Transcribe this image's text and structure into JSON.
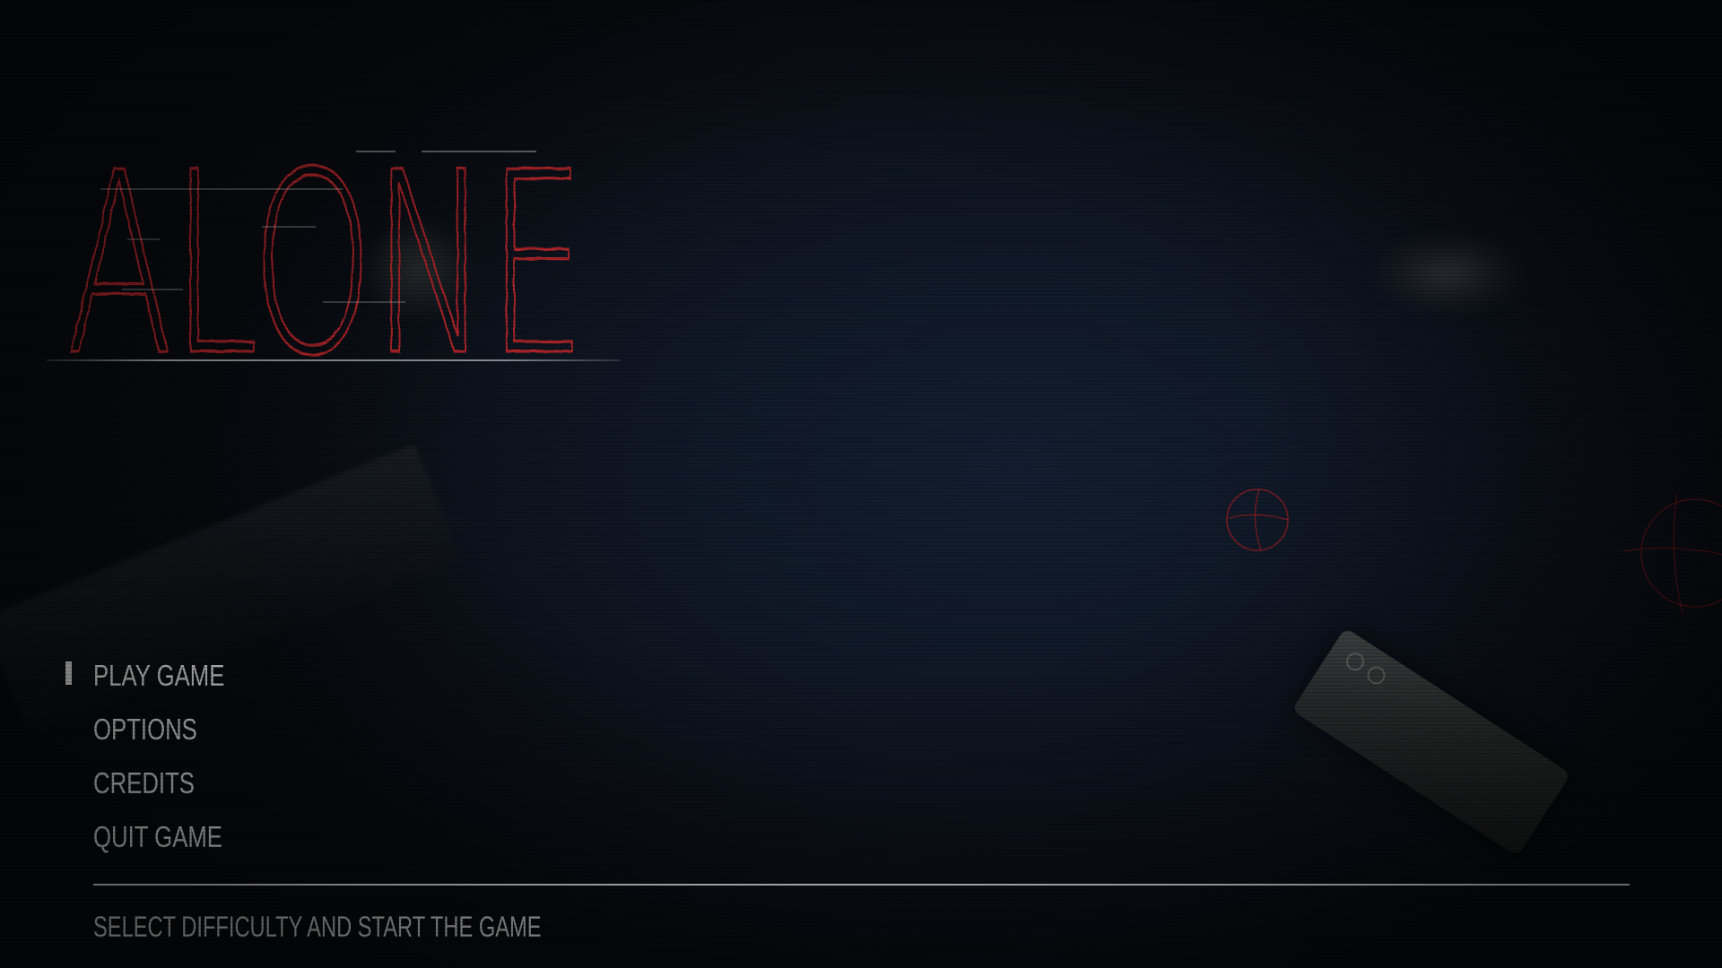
{
  "game": {
    "title": "ALONE"
  },
  "menu": {
    "selected_index": 0,
    "items": [
      {
        "label": "PLAY GAME"
      },
      {
        "label": "OPTIONS"
      },
      {
        "label": "CREDITS"
      },
      {
        "label": "QUIT GAME"
      }
    ]
  },
  "footer": {
    "hint": "SELECT DIFFICULTY AND START THE GAME"
  },
  "colors": {
    "background": "#0c1119",
    "title_red": "#b3262b",
    "menu_text": "#f0f0f0",
    "divider": "#e6e6e6"
  }
}
